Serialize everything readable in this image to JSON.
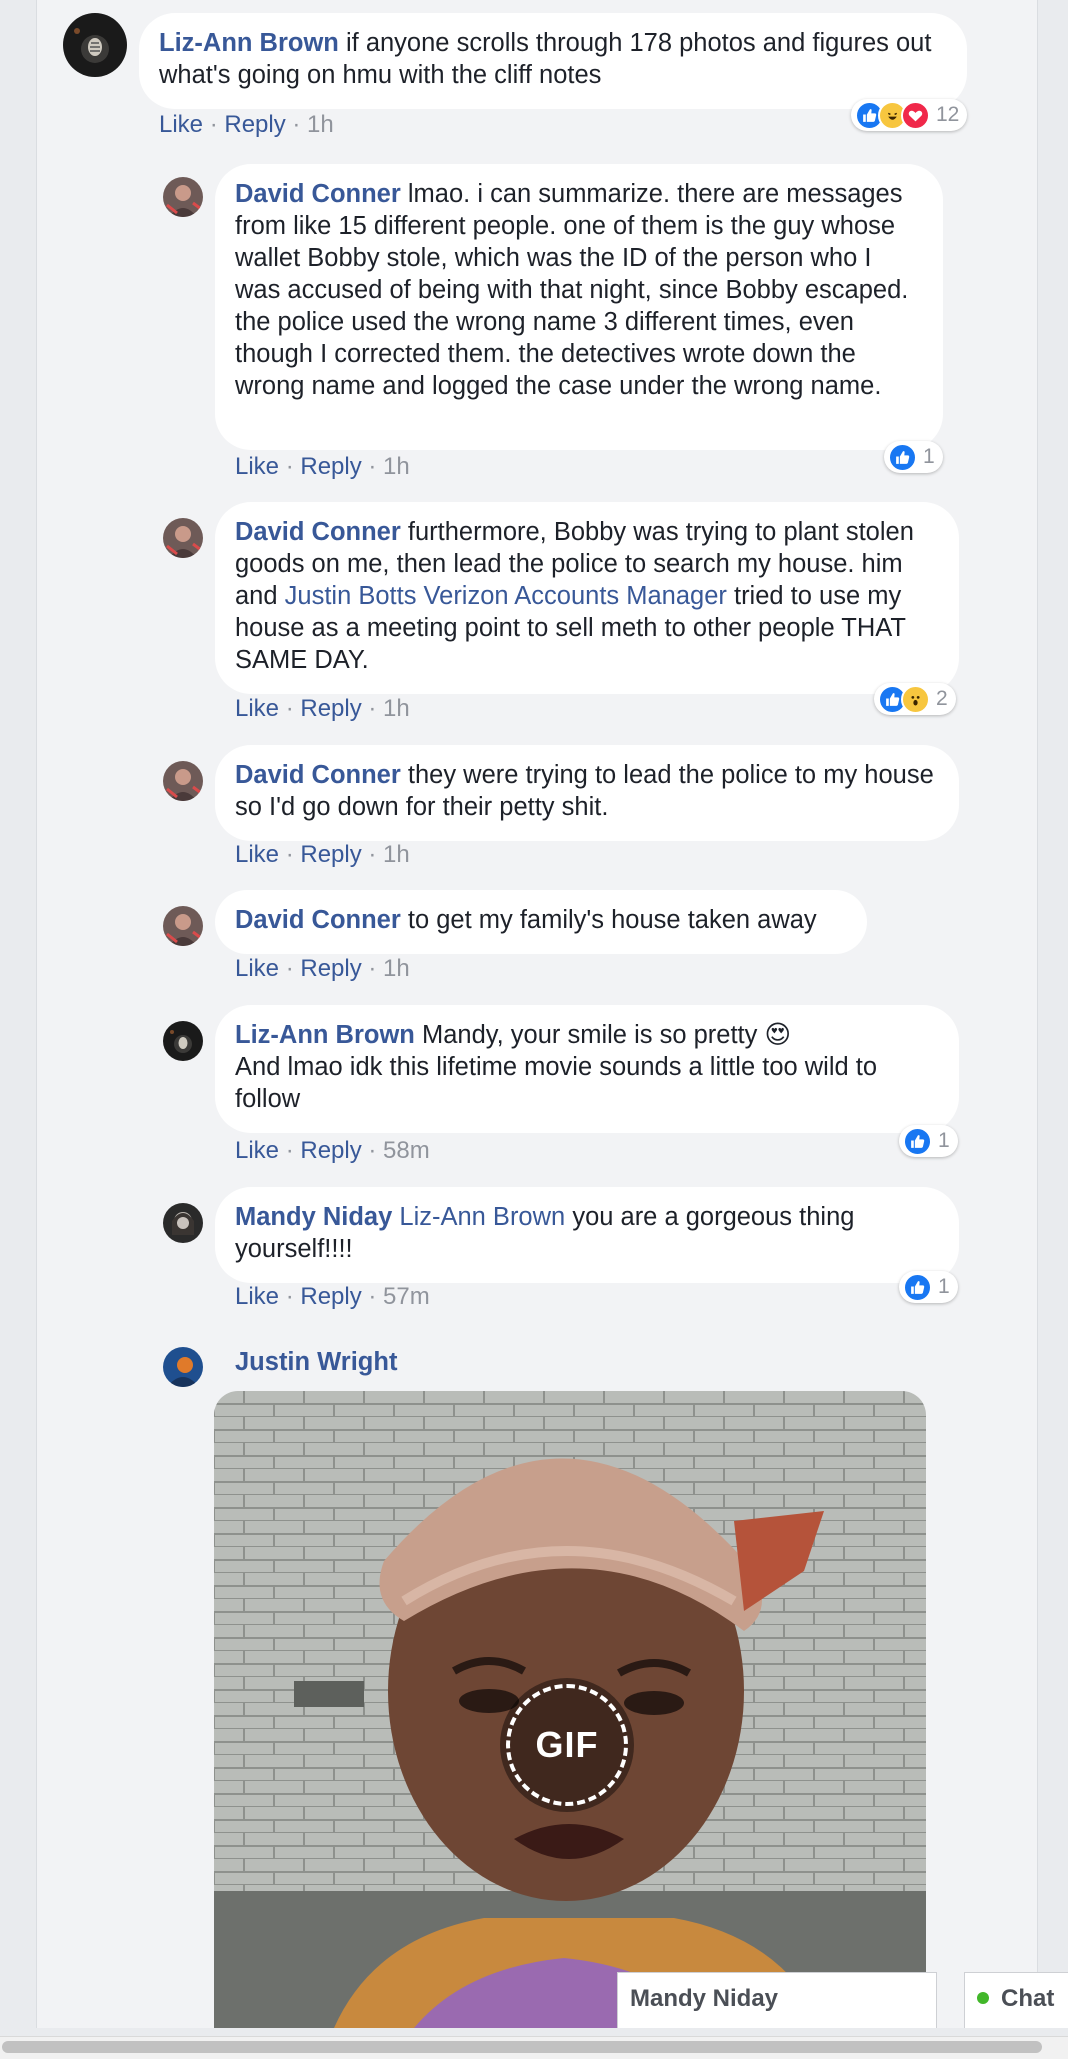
{
  "colors": {
    "author": "#385898",
    "meta": "#90949c",
    "bubble": "#ffffff",
    "like": "#1877f2",
    "online": "#42b72a"
  },
  "actions": {
    "like": "Like",
    "reply": "Reply",
    "sep": " · "
  },
  "comments": [
    {
      "author": "Liz-Ann Brown",
      "text": "if anyone scrolls through 178 photos and figures out what's going on hmu with the cliff notes",
      "time": "1h",
      "reactions": [
        "like-icon",
        "haha-icon",
        "love-icon"
      ],
      "reaction_count": "12"
    },
    {
      "author": "David Conner",
      "text": "lmao. i can summarize. there are messages from like 15 different people. one of them is the guy whose wallet Bobby stole, which was the ID of the person who I was accused of being with that night, since Bobby escaped. the police used the wrong name 3 different times, even though I corrected them. the detectives wrote down the wrong name and logged the case under the wrong name.",
      "time": "1h",
      "reactions": [
        "like-icon"
      ],
      "reaction_count": "1"
    },
    {
      "author": "David Conner",
      "text_before": "furthermore, Bobby was trying to plant stolen goods on me, then lead the police to search my house. him and",
      "mention": "Justin Botts Verizon Accounts Manager",
      "text_after": "tried to use my house as a meeting point to sell meth to other people THAT SAME DAY.",
      "time": "1h",
      "reactions": [
        "like-icon",
        "wow-icon"
      ],
      "reaction_count": "2"
    },
    {
      "author": "David Conner",
      "text": "they were trying to lead the police to my house so I'd go down for their petty shit.",
      "time": "1h"
    },
    {
      "author": "David Conner",
      "text": "to get my family's house taken away",
      "time": "1h"
    },
    {
      "author": "Liz-Ann Brown",
      "text": "Mandy, your smile is so pretty",
      "emoji": "😍",
      "text_line2": "And lmao idk this lifetime movie sounds a little too wild to follow",
      "time": "58m",
      "reactions": [
        "like-icon"
      ],
      "reaction_count": "1"
    },
    {
      "author": "Mandy Niday",
      "mention": "Liz-Ann Brown",
      "text": "you are a gorgeous thing yourself!!!!",
      "time": "57m",
      "reactions": [
        "like-icon"
      ],
      "reaction_count": "1"
    },
    {
      "author": "Justin Wright",
      "attachment": {
        "badge": "GIF"
      }
    }
  ],
  "chat_tabs": {
    "conversation": "Mandy Niday",
    "main": "Chat"
  }
}
